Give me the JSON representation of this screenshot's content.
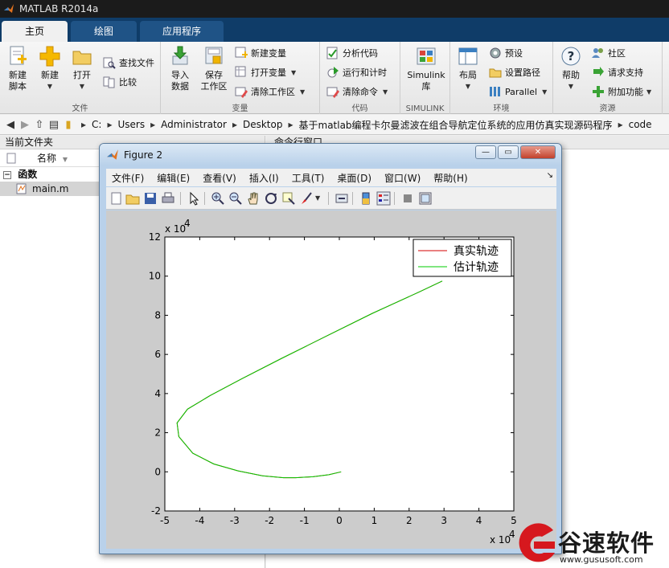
{
  "app": {
    "title": "MATLAB R2014a",
    "tabs": [
      {
        "label": "主页",
        "active": true
      },
      {
        "label": "绘图",
        "active": false
      },
      {
        "label": "应用程序",
        "active": false
      }
    ]
  },
  "ribbon": {
    "file": {
      "label": "文件",
      "new_script": "新建\n脚本",
      "new": "新建",
      "open": "打开",
      "find_files": "查找文件",
      "compare": "比较"
    },
    "variable": {
      "label": "变量",
      "import_data": "导入\n数据",
      "save_workspace": "保存\n工作区",
      "new_variable": "新建变量",
      "open_variable": "打开变量",
      "clear_workspace": "清除工作区"
    },
    "code": {
      "label": "代码",
      "analyze_code": "分析代码",
      "run_and_time": "运行和计时",
      "clear_commands": "清除命令"
    },
    "simulink": {
      "label": "SIMULINK",
      "library": "Simulink\n库"
    },
    "environment": {
      "label": "环境",
      "layout": "布局",
      "preferences": "预设",
      "set_path": "设置路径",
      "parallel": "Parallel"
    },
    "resources": {
      "label": "资源",
      "help": "帮助",
      "community": "社区",
      "request_support": "请求支持",
      "add_ons": "附加功能"
    }
  },
  "address": {
    "parts": [
      "C:",
      "Users",
      "Administrator",
      "Desktop",
      "基于matlab编程卡尔曼滤波在组合导航定位系统的应用仿真实现源码程序",
      "code"
    ]
  },
  "current_folder": {
    "title": "当前文件夹",
    "column_name": "名称",
    "group": "函数",
    "file": "main.m"
  },
  "command_window": {
    "title": "命令行窗口"
  },
  "figure": {
    "title": "Figure 2",
    "menus": [
      "文件(F)",
      "编辑(E)",
      "查看(V)",
      "插入(I)",
      "工具(T)",
      "桌面(D)",
      "窗口(W)",
      "帮助(H)"
    ],
    "colors": {
      "true_track": "#d40000",
      "estimated_track": "#00cc00"
    }
  },
  "chart_data": {
    "type": "line",
    "title": "",
    "xlabel": "",
    "ylabel": "",
    "x_multiplier": "x 10",
    "x_exponent": "4",
    "y_multiplier": "x 10",
    "y_exponent": "4",
    "xlim": [
      -5,
      5
    ],
    "ylim": [
      -2,
      12
    ],
    "xticks": [
      -5,
      -4,
      -3,
      -2,
      -1,
      0,
      1,
      2,
      3,
      4,
      5
    ],
    "yticks": [
      -2,
      0,
      2,
      4,
      6,
      8,
      10,
      12
    ],
    "grid": false,
    "legend_position": "top-right",
    "series": [
      {
        "name": "真实轨迹",
        "color": "#d40000",
        "x": [
          0.05,
          -0.3,
          -0.75,
          -1.25,
          -1.6,
          -2.2,
          -2.9,
          -3.6,
          -4.2,
          -4.6,
          -4.65,
          -4.35,
          -3.7,
          -2.8,
          -1.65,
          -0.3,
          0.95,
          2.3,
          2.95
        ],
        "y": [
          0.0,
          -0.15,
          -0.25,
          -0.3,
          -0.3,
          -0.2,
          0.05,
          0.4,
          0.95,
          1.8,
          2.5,
          3.2,
          3.9,
          4.75,
          5.8,
          7.0,
          8.1,
          9.2,
          9.75
        ]
      },
      {
        "name": "估计轨迹",
        "color": "#00cc00",
        "x": [
          0.05,
          -0.3,
          -0.75,
          -1.25,
          -1.6,
          -2.2,
          -2.9,
          -3.6,
          -4.2,
          -4.6,
          -4.65,
          -4.35,
          -3.7,
          -2.8,
          -1.65,
          -0.3,
          0.95,
          2.3,
          2.95
        ],
        "y": [
          0.0,
          -0.15,
          -0.25,
          -0.3,
          -0.3,
          -0.2,
          0.05,
          0.4,
          0.95,
          1.8,
          2.5,
          3.2,
          3.9,
          4.75,
          5.8,
          7.0,
          8.1,
          9.2,
          9.75
        ]
      }
    ]
  },
  "watermark": {
    "brand": "谷速软件",
    "url": "www.gususoft.com"
  }
}
